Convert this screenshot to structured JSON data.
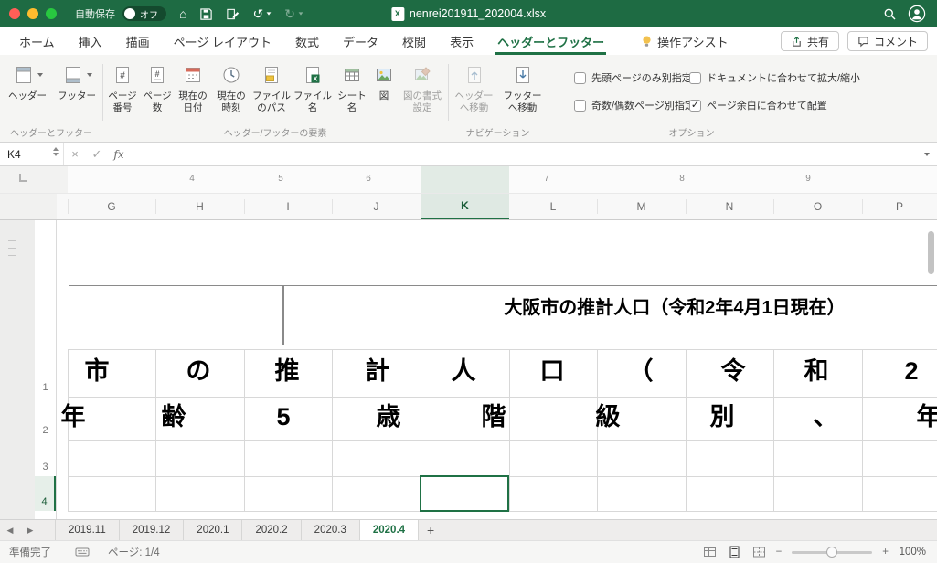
{
  "window": {
    "autosave_label": "自動保存",
    "autosave_state": "オフ",
    "filename": "nenrei201911_202004.xlsx"
  },
  "icons": {
    "home": "⌂",
    "undo": "↺",
    "redo": "↻",
    "check": "✓",
    "close": "×",
    "prev": "◀",
    "next": "▶",
    "add": "+",
    "minus": "−",
    "plus": "+",
    "excel": "X"
  },
  "tabs": {
    "items": [
      "ホーム",
      "挿入",
      "描画",
      "ページ レイアウト",
      "数式",
      "データ",
      "校閲",
      "表示",
      "ヘッダーとフッター",
      "操作アシスト"
    ],
    "active": "ヘッダーとフッター",
    "share": "共有",
    "comments": "コメント"
  },
  "ribbon": {
    "groups": [
      {
        "label": "ヘッダーとフッター"
      },
      {
        "label": "ヘッダー/フッターの要素"
      },
      {
        "label": "ナビゲーション"
      },
      {
        "label": "オプション"
      }
    ],
    "buttons": {
      "header": "ヘッダー",
      "footer": "フッター",
      "page_number": [
        "ページ",
        "番号"
      ],
      "page_count": [
        "ページ",
        "数"
      ],
      "current_date": [
        "現在の",
        "日付"
      ],
      "current_time": [
        "現在の",
        "時刻"
      ],
      "file_path": [
        "ファイル",
        "のパス"
      ],
      "file_name": [
        "ファイル",
        "名"
      ],
      "sheet_name": [
        "シート",
        "名"
      ],
      "picture": [
        "図",
        ""
      ],
      "format_picture": [
        "図の書式",
        "設定"
      ],
      "goto_header": [
        "ヘッダー",
        "へ移動"
      ],
      "goto_footer": [
        "フッター",
        "へ移動"
      ]
    },
    "options": [
      {
        "label": "先頭ページのみ別指定",
        "checked": false
      },
      {
        "label": "奇数/偶数ページ別指定",
        "checked": false
      },
      {
        "label": "ドキュメントに合わせて拡大/縮小",
        "checked": false
      },
      {
        "label": "ページ余白に合わせて配置",
        "checked": true
      }
    ]
  },
  "formula_bar": {
    "name_box": "K4",
    "fx": "fx"
  },
  "ruler": {
    "numbers": [
      "4",
      "5",
      "6",
      "7",
      "8",
      "9"
    ]
  },
  "grid": {
    "columns": [
      "G",
      "H",
      "I",
      "J",
      "K",
      "L",
      "M",
      "N",
      "O",
      "P"
    ],
    "selected_column": "K",
    "rows": [
      "1",
      "2",
      "3",
      "4"
    ],
    "selected_cell": "K4",
    "header_title": "大阪市の推計人口（令和2年4月1日現在）",
    "row1": [
      "市",
      "の",
      "推",
      "計",
      "人",
      "口",
      "（",
      "令",
      "和",
      "2"
    ],
    "row2": [
      "年",
      "齢",
      "5",
      "歳",
      "階",
      "級",
      "別",
      "、",
      "年"
    ]
  },
  "sheet_tabs": {
    "items": [
      "2019.11",
      "2019.12",
      "2020.1",
      "2020.2",
      "2020.3",
      "2020.4"
    ],
    "active": "2020.4"
  },
  "status_bar": {
    "ready": "準備完了",
    "page": "ページ: 1/4",
    "zoom": "100%"
  },
  "colors": {
    "accent": "#1f7145",
    "titlebar": "#1e6b43",
    "selection_tint": "#dfe9e3"
  }
}
